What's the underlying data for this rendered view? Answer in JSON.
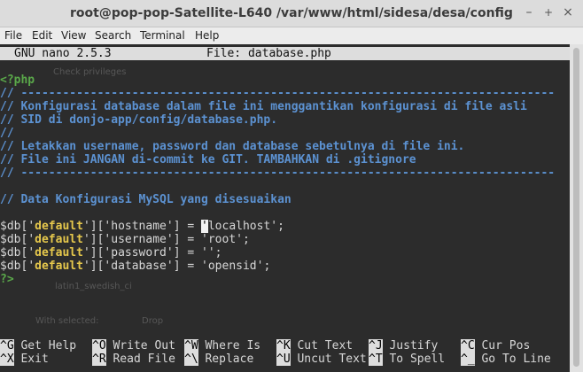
{
  "window": {
    "title": "root@pop-pop-Satellite-L640 /var/www/html/sidesa/desa/config",
    "minimize_glyph": "–",
    "maximize_glyph": "+",
    "close_glyph": "×"
  },
  "menu": [
    "File",
    "Edit",
    "View",
    "Search",
    "Terminal",
    "Help"
  ],
  "nano": {
    "version": "GNU nano 2.5.3",
    "file": "File: database.php"
  },
  "code": {
    "php_open": "<?php",
    "sep1": "// -----------------------------------------------------------------------------",
    "c1": "// Konfigurasi database dalam file ini menggantikan konfigurasi di file asli",
    "c2": "// SID di donjo-app/config/database.php.",
    "c3": "//",
    "c4": "// Letakkan username, password dan database sebetulnya di file ini.",
    "c5": "// File ini JANGAN di-commit ke GIT. TAMBAHKAN di .gitignore",
    "sep2": "// -----------------------------------------------------------------------------",
    "c6": "// Data Konfigurasi MySQL yang disesuaikan",
    "db_var": "$db[",
    "q": "'",
    "default": "default",
    "mid": "'][",
    "end_assign": "] = ",
    "semi": ";",
    "host_key": "'hostname'",
    "host_q": "'",
    "host_val": "localhost'",
    "user_key": "'username'",
    "user_val": "'root'",
    "pass_key": "'password'",
    "pass_val": "''",
    "dbn_key": "'database'",
    "dbn_val": "'opensid'",
    "php_close": "?>"
  },
  "shortcuts": [
    {
      "key": "^G",
      "label": "Get Help"
    },
    {
      "key": "^O",
      "label": "Write Out"
    },
    {
      "key": "^W",
      "label": "Where Is"
    },
    {
      "key": "^K",
      "label": "Cut Text"
    },
    {
      "key": "^J",
      "label": "Justify"
    },
    {
      "key": "^C",
      "label": "Cur Pos"
    },
    {
      "key": "^X",
      "label": "Exit"
    },
    {
      "key": "^R",
      "label": "Read File"
    },
    {
      "key": "^\\",
      "label": "Replace"
    },
    {
      "key": "^U",
      "label": "Uncut Text"
    },
    {
      "key": "^T",
      "label": "To Spell"
    },
    {
      "key": "^_",
      "label": "Go To Line"
    }
  ],
  "ghost": {
    "g1": "latin1_swedish_ci",
    "g2": "With selected:",
    "g3": "Drop",
    "g4": "Check privileges"
  }
}
